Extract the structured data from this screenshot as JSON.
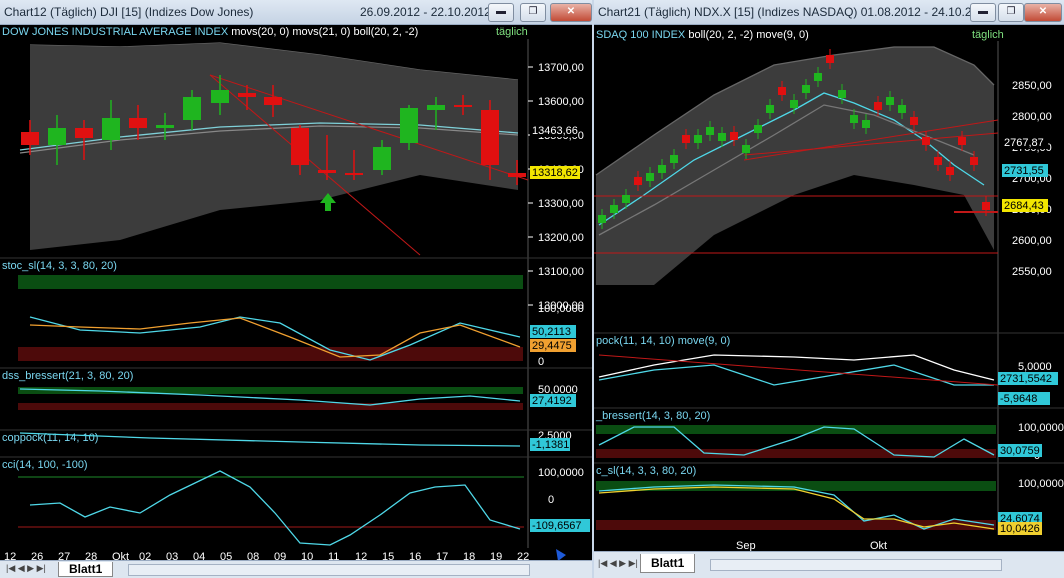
{
  "windows": [
    {
      "title": "Chart12 (Täglich)  DJI [15] (Indizes Dow Jones)",
      "dates": "26.09.2012 - 22.10.2012",
      "main_label": "DOW JONES INDUSTRIAL AVERAGE INDEX",
      "main_indicators": "movs(20, 0) movs(21, 0) boll(20, 2, -2)",
      "period_label": "täglich",
      "price_ticks": [
        "13700,00",
        "13600,00",
        "13500,00",
        "13400,00",
        "13300,00",
        "13200,00",
        "13100,00",
        "13000,00"
      ],
      "price_badges": [
        "13463,66",
        "13318,62"
      ],
      "panels": [
        {
          "label": "stoc_sl(14, 3, 3, 80, 20)",
          "ticks": [
            "100,0000",
            "0"
          ],
          "badges": [
            "50,2113",
            "29,4475"
          ]
        },
        {
          "label": "dss_bressert(21, 3, 80, 20)",
          "ticks": [
            "50,0000"
          ],
          "badges": [
            "27,4192"
          ]
        },
        {
          "label": "coppock(11, 14, 10)",
          "ticks": [
            "2,5000"
          ],
          "badges": [
            "-1,1381"
          ]
        },
        {
          "label": "cci(14, 100, -100)",
          "ticks": [
            "100,0000",
            "0"
          ],
          "badges": [
            "-109,6567"
          ]
        }
      ],
      "x_ticks": [
        "12",
        "26",
        "27",
        "28",
        "Okt",
        "02",
        "03",
        "04",
        "05",
        "08",
        "09",
        "10",
        "11",
        "12",
        "15",
        "16",
        "17",
        "18",
        "19",
        "22"
      ],
      "sheet_tab": "Blatt1",
      "colors": {
        "up": "#1fb51f",
        "down": "#e01010",
        "band": "#4a4a4a"
      }
    },
    {
      "title": "Chart21 (Täglich)  NDX.X [15] (Indizes NASDAQ) 01.08.2012 - 24.10.20...",
      "main_label": "SDAQ 100 INDEX",
      "main_indicators": "boll(20, 2, -2) move(9, 0)",
      "period_label": "täglich",
      "price_ticks": [
        "2850,00",
        "2800,00",
        "2750,00",
        "2700,00",
        "2650,00",
        "2600,00",
        "2550,00"
      ],
      "price_badges": [
        "2767,87",
        "2731,55",
        "2684,43"
      ],
      "panels": [
        {
          "label": "pock(11, 14, 10) move(9, 0)",
          "ticks": [
            "5,0000"
          ],
          "badges": [
            "2731,5542",
            "-5,9648"
          ]
        },
        {
          "label": "_bressert(14, 3, 80, 20)",
          "ticks": [
            "100,0000",
            "0"
          ],
          "badges": [
            "30,0759"
          ]
        },
        {
          "label": "c_sl(14, 3, 3, 80, 20)",
          "ticks": [
            "100,0000",
            "0"
          ],
          "badges": [
            "24,6074",
            "10,0426"
          ]
        }
      ],
      "x_ticks": [
        "Sep",
        "Okt"
      ],
      "sheet_tab": "Blatt1"
    }
  ],
  "window_buttons": {
    "minimize": "▬",
    "restore": "❐",
    "close": "✕"
  }
}
